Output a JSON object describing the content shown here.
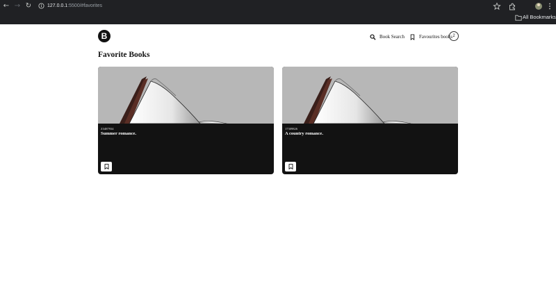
{
  "browser": {
    "url_host": "127.0.0.1",
    "url_path": ":5500/#favorites",
    "bookmarks_label": "All Bookmarks"
  },
  "header": {
    "logo_letter": "B",
    "search_link": "Book Search",
    "favorites_link": "Favourites books",
    "favorites_count": "2"
  },
  "page": {
    "title": "Favorite Books"
  },
  "books": [
    {
      "id": "Z3487934",
      "title": "Summer romance."
    },
    {
      "id": "17309826",
      "title": "A country romance."
    }
  ],
  "colors": {
    "chrome_bg": "#202124",
    "card_bg": "#121212",
    "image_bg": "#b7b7b7",
    "accent": "#111111"
  }
}
